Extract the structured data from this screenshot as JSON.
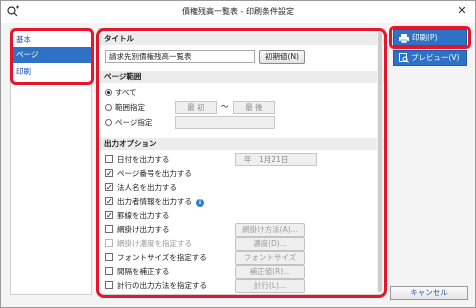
{
  "window": {
    "title": "債権残高一覧表 - 印刷条件設定",
    "close_glyph": "✕"
  },
  "nav": {
    "items": [
      "基本",
      "ページ",
      "印刷"
    ],
    "selected": 1
  },
  "title_section": {
    "header": "タイトル",
    "value": "請求先別債権残高一覧表",
    "reset_label": "初期値(N)"
  },
  "page_range": {
    "header": "ページ範囲",
    "options": [
      "すべて",
      "範囲指定",
      "ページ指定"
    ],
    "selected": 0,
    "from_placeholder": "最 初",
    "separator": "〜",
    "to_placeholder": "最 後"
  },
  "output_options": {
    "header": "出力オプション",
    "date_value": "年　1月21日",
    "items": [
      {
        "label": "日付を出力する",
        "checked": false,
        "enabled": true
      },
      {
        "label": "ページ番号を出力する",
        "checked": true,
        "enabled": true
      },
      {
        "label": "法人名を出力する",
        "checked": true,
        "enabled": true
      },
      {
        "label": "出力者情報を出力する",
        "checked": true,
        "enabled": true,
        "info": true
      },
      {
        "label": "罫線を出力する",
        "checked": true,
        "enabled": true
      },
      {
        "label": "網掛け出力する",
        "checked": false,
        "enabled": true,
        "button": "網掛け方法(A)..."
      },
      {
        "label": "網掛け濃度を指定する",
        "checked": false,
        "enabled": false,
        "button": "濃度(D)..."
      },
      {
        "label": "フォントサイズを指定する",
        "checked": false,
        "enabled": true,
        "button": "フォントサイズ(Z)..."
      },
      {
        "label": "間隔を補正する",
        "checked": false,
        "enabled": true,
        "button": "補正値(R)..."
      },
      {
        "label": "計行の出力方法を指定する",
        "checked": false,
        "enabled": true,
        "button": "計行(L)..."
      }
    ]
  },
  "actions": {
    "print": "印刷(P)",
    "preview": "プレビュー(V)",
    "cancel": "キャンセル"
  },
  "colors": {
    "accent": "#2e72c5",
    "highlight": "#e8142a"
  }
}
